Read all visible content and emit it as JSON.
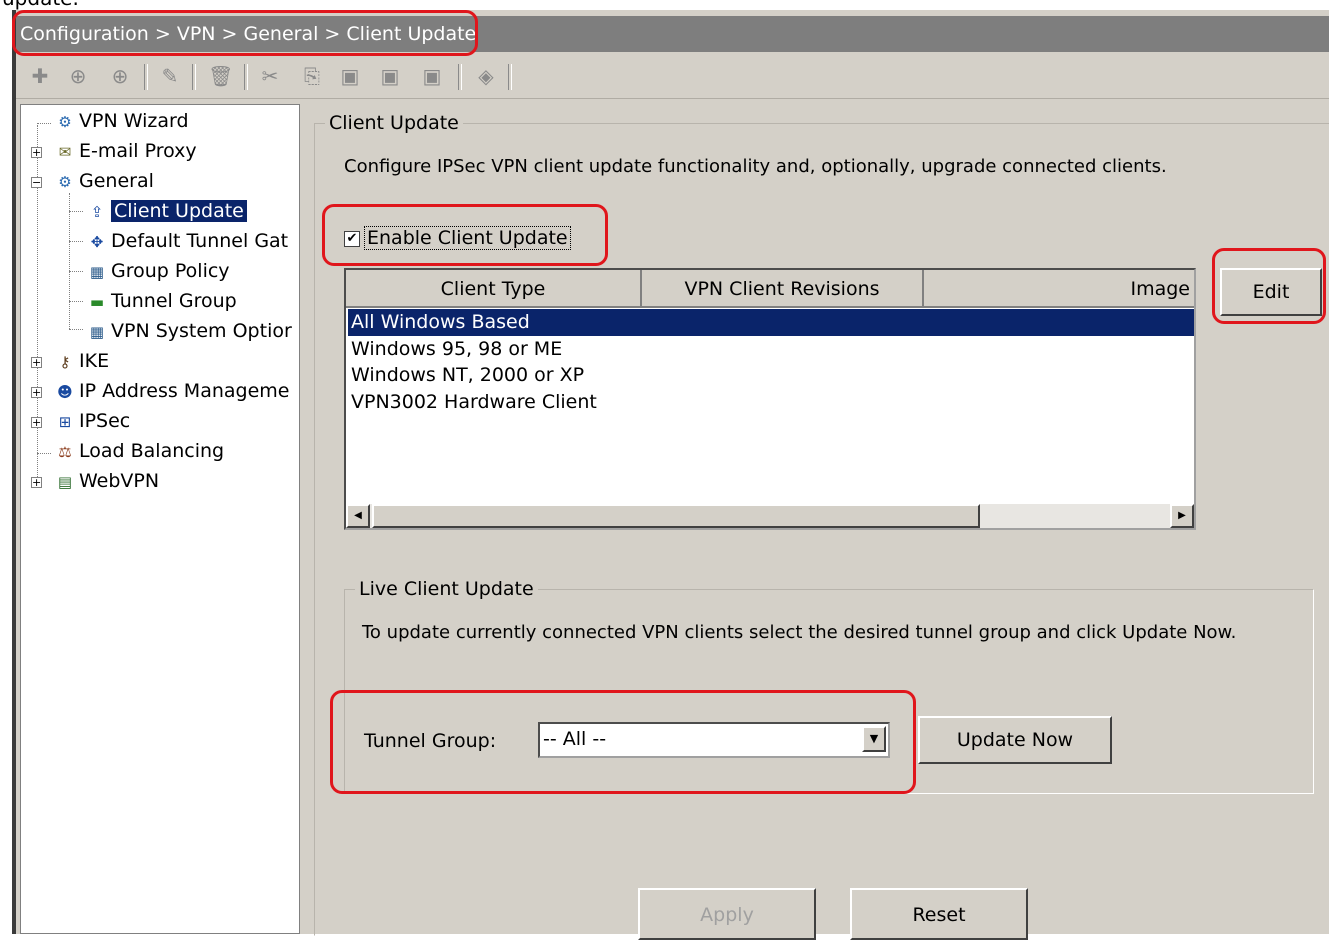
{
  "caption_fragment": "update.",
  "titlebar": {
    "breadcrumb": "Configuration > VPN > General > Client Update"
  },
  "toolbar": {
    "icons": [
      "add-icon",
      "insert-after-icon",
      "insert-before-icon",
      "edit-icon",
      "delete-icon",
      "cut-icon",
      "copy-icon",
      "paste-icon",
      "paste-after-icon",
      "paste-before-icon",
      "find-icon"
    ]
  },
  "tree": {
    "items": [
      {
        "label": "VPN Wizard",
        "icon": "wizard-icon",
        "expander": "none"
      },
      {
        "label": "E-mail Proxy",
        "icon": "email-proxy-icon",
        "expander": "+"
      },
      {
        "label": "General",
        "icon": "general-icon",
        "expander": "-"
      },
      {
        "label": "Client Update",
        "icon": "client-update-icon",
        "selected": true
      },
      {
        "label": "Default Tunnel Gat",
        "icon": "default-tunnel-gateway-icon"
      },
      {
        "label": "Group Policy",
        "icon": "group-policy-icon"
      },
      {
        "label": "Tunnel Group",
        "icon": "tunnel-group-icon"
      },
      {
        "label": "VPN System Optior",
        "icon": "vpn-system-options-icon"
      },
      {
        "label": "IKE",
        "icon": "ike-icon",
        "expander": "+"
      },
      {
        "label": "IP Address Manageme",
        "icon": "ip-address-management-icon",
        "expander": "+"
      },
      {
        "label": "IPSec",
        "icon": "ipsec-icon",
        "expander": "+"
      },
      {
        "label": "Load Balancing",
        "icon": "load-balancing-icon",
        "expander": "none"
      },
      {
        "label": "WebVPN",
        "icon": "webvpn-icon",
        "expander": "+"
      }
    ]
  },
  "client_update": {
    "legend": "Client Update",
    "description": "Configure IPSec VPN client update functionality and, optionally, upgrade connected clients.",
    "enable_label": "Enable Client Update",
    "enable_checked": true,
    "table": {
      "columns": [
        "Client Type",
        "VPN Client Revisions",
        "Image"
      ],
      "rows": [
        "All Windows Based",
        "Windows 95, 98 or ME",
        "Windows NT, 2000 or XP",
        "VPN3002 Hardware Client"
      ]
    },
    "edit_label": "Edit"
  },
  "live_update": {
    "legend": "Live Client Update",
    "description": "To update currently connected VPN clients select the desired tunnel group and click Update Now.",
    "tunnel_group_label": "Tunnel Group:",
    "tunnel_group_value": "-- All --",
    "update_now_label": "Update Now"
  },
  "footer": {
    "apply_label": "Apply",
    "reset_label": "Reset"
  },
  "colors": {
    "highlight": "#e0161c",
    "selection": "#0a246a",
    "panel": "#d4d0c8"
  }
}
